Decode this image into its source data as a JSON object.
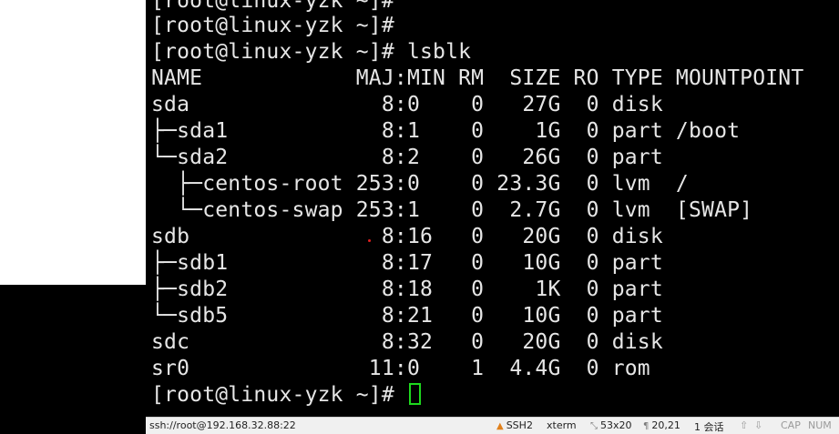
{
  "terminal": {
    "lines": [
      "[root@linux-yzk ~]#",
      "[root@linux-yzk ~]#",
      "[root@linux-yzk ~]# lsblk",
      "NAME            MAJ:MIN RM  SIZE RO TYPE MOUNTPOINT",
      "sda               8:0    0   27G  0 disk",
      "├─sda1            8:1    0    1G  0 part /boot",
      "└─sda2            8:2    0   26G  0 part",
      "  ├─centos-root 253:0    0 23.3G  0 lvm  /",
      "  └─centos-swap 253:1    0  2.7G  0 lvm  [SWAP]",
      "sdb               8:16   0   20G  0 disk",
      "├─sdb1            8:17   0   10G  0 part",
      "├─sdb2            8:18   0    1K  0 part",
      "└─sdb5            8:21   0   10G  0 part",
      "sdc               8:32   0   20G  0 disk",
      "sr0              11:0    1  4.4G  0 rom"
    ],
    "prompt": "[root@linux-yzk ~]# "
  },
  "status_bar": {
    "session": "ssh://root@192.168.32.88:22",
    "protocol": "SSH2",
    "terminal_type": "xterm",
    "size": "53x20",
    "cursor_pos": "20,21",
    "sessions": "1 会话",
    "caps": "CAP",
    "num": "NUM",
    "icons": {
      "protocol": "lock-icon",
      "size": "resize-icon",
      "cursor": "cursor-icon",
      "nav_up": "arrow-up-icon",
      "nav_down": "arrow-down-icon"
    }
  },
  "colors": {
    "terminal_bg": "#000000",
    "terminal_fg": "#e6e6e6",
    "cursor": "#1ed81e",
    "status_bg": "#f0f0f0"
  }
}
